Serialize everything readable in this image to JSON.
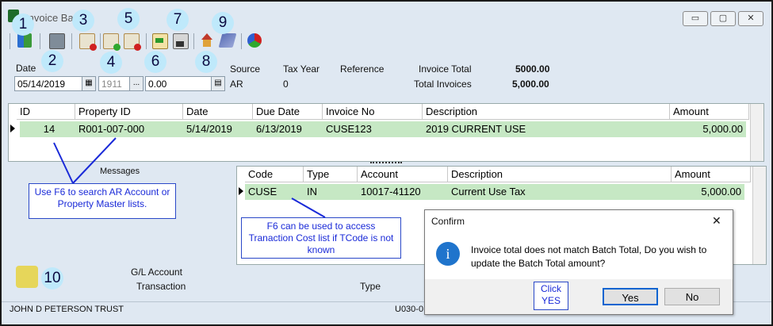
{
  "window": {
    "title": "Invoice Batch",
    "min_label": "▭",
    "max_label": "▢",
    "close_label": "✕"
  },
  "callouts": [
    "1",
    "2",
    "3",
    "4",
    "5",
    "6",
    "7",
    "8",
    "9",
    "10"
  ],
  "form": {
    "date_label": "Date",
    "date_value": "05/14/2019",
    "year_value": "1911",
    "ellipsis_label": "...",
    "total_value": "0.00",
    "source_label": "Source",
    "source_value": "AR",
    "tax_year_label": "Tax Year",
    "tax_year_value": "0",
    "reference_label": "Reference",
    "invoice_total_label": "Invoice Total",
    "invoice_total_value": "5000.00",
    "total_invoices_label": "Total Invoices",
    "total_invoices_value": "5,000.00"
  },
  "invoice_grid": {
    "headers": [
      "ID",
      "Property ID",
      "Date",
      "Due Date",
      "Invoice No",
      "Description",
      "Amount"
    ],
    "row": [
      "14",
      "R001-007-000",
      "5/14/2019",
      "6/13/2019",
      "CUSE123",
      "2019 CURRENT USE",
      "5,000.00"
    ]
  },
  "messages_label": "Messages",
  "notes": {
    "note1": "Use F6 to search AR Account or Property Master lists.",
    "note2": "F6 can be used to access Tranaction Cost list if TCode is not known",
    "click_yes": "Click YES"
  },
  "cost_grid": {
    "headers": [
      "Code",
      "Type",
      "Account",
      "Description",
      "Amount"
    ],
    "row": [
      "CUSE",
      "IN",
      "10017-41120",
      "Current Use Tax",
      "5,000.00"
    ]
  },
  "gl": {
    "gl_account_label": "G/L Account",
    "transaction_label": "Transaction",
    "type_label": "Type"
  },
  "confirm": {
    "title": "Confirm",
    "close": "✕",
    "message": "Invoice total does not match Batch Total, Do you wish to update the Batch Total amount?",
    "icon_glyph": "i",
    "yes": "Yes",
    "no": "No"
  },
  "status": {
    "owner": "JOHN D PETERSON TRUST",
    "code": "U030-0"
  }
}
